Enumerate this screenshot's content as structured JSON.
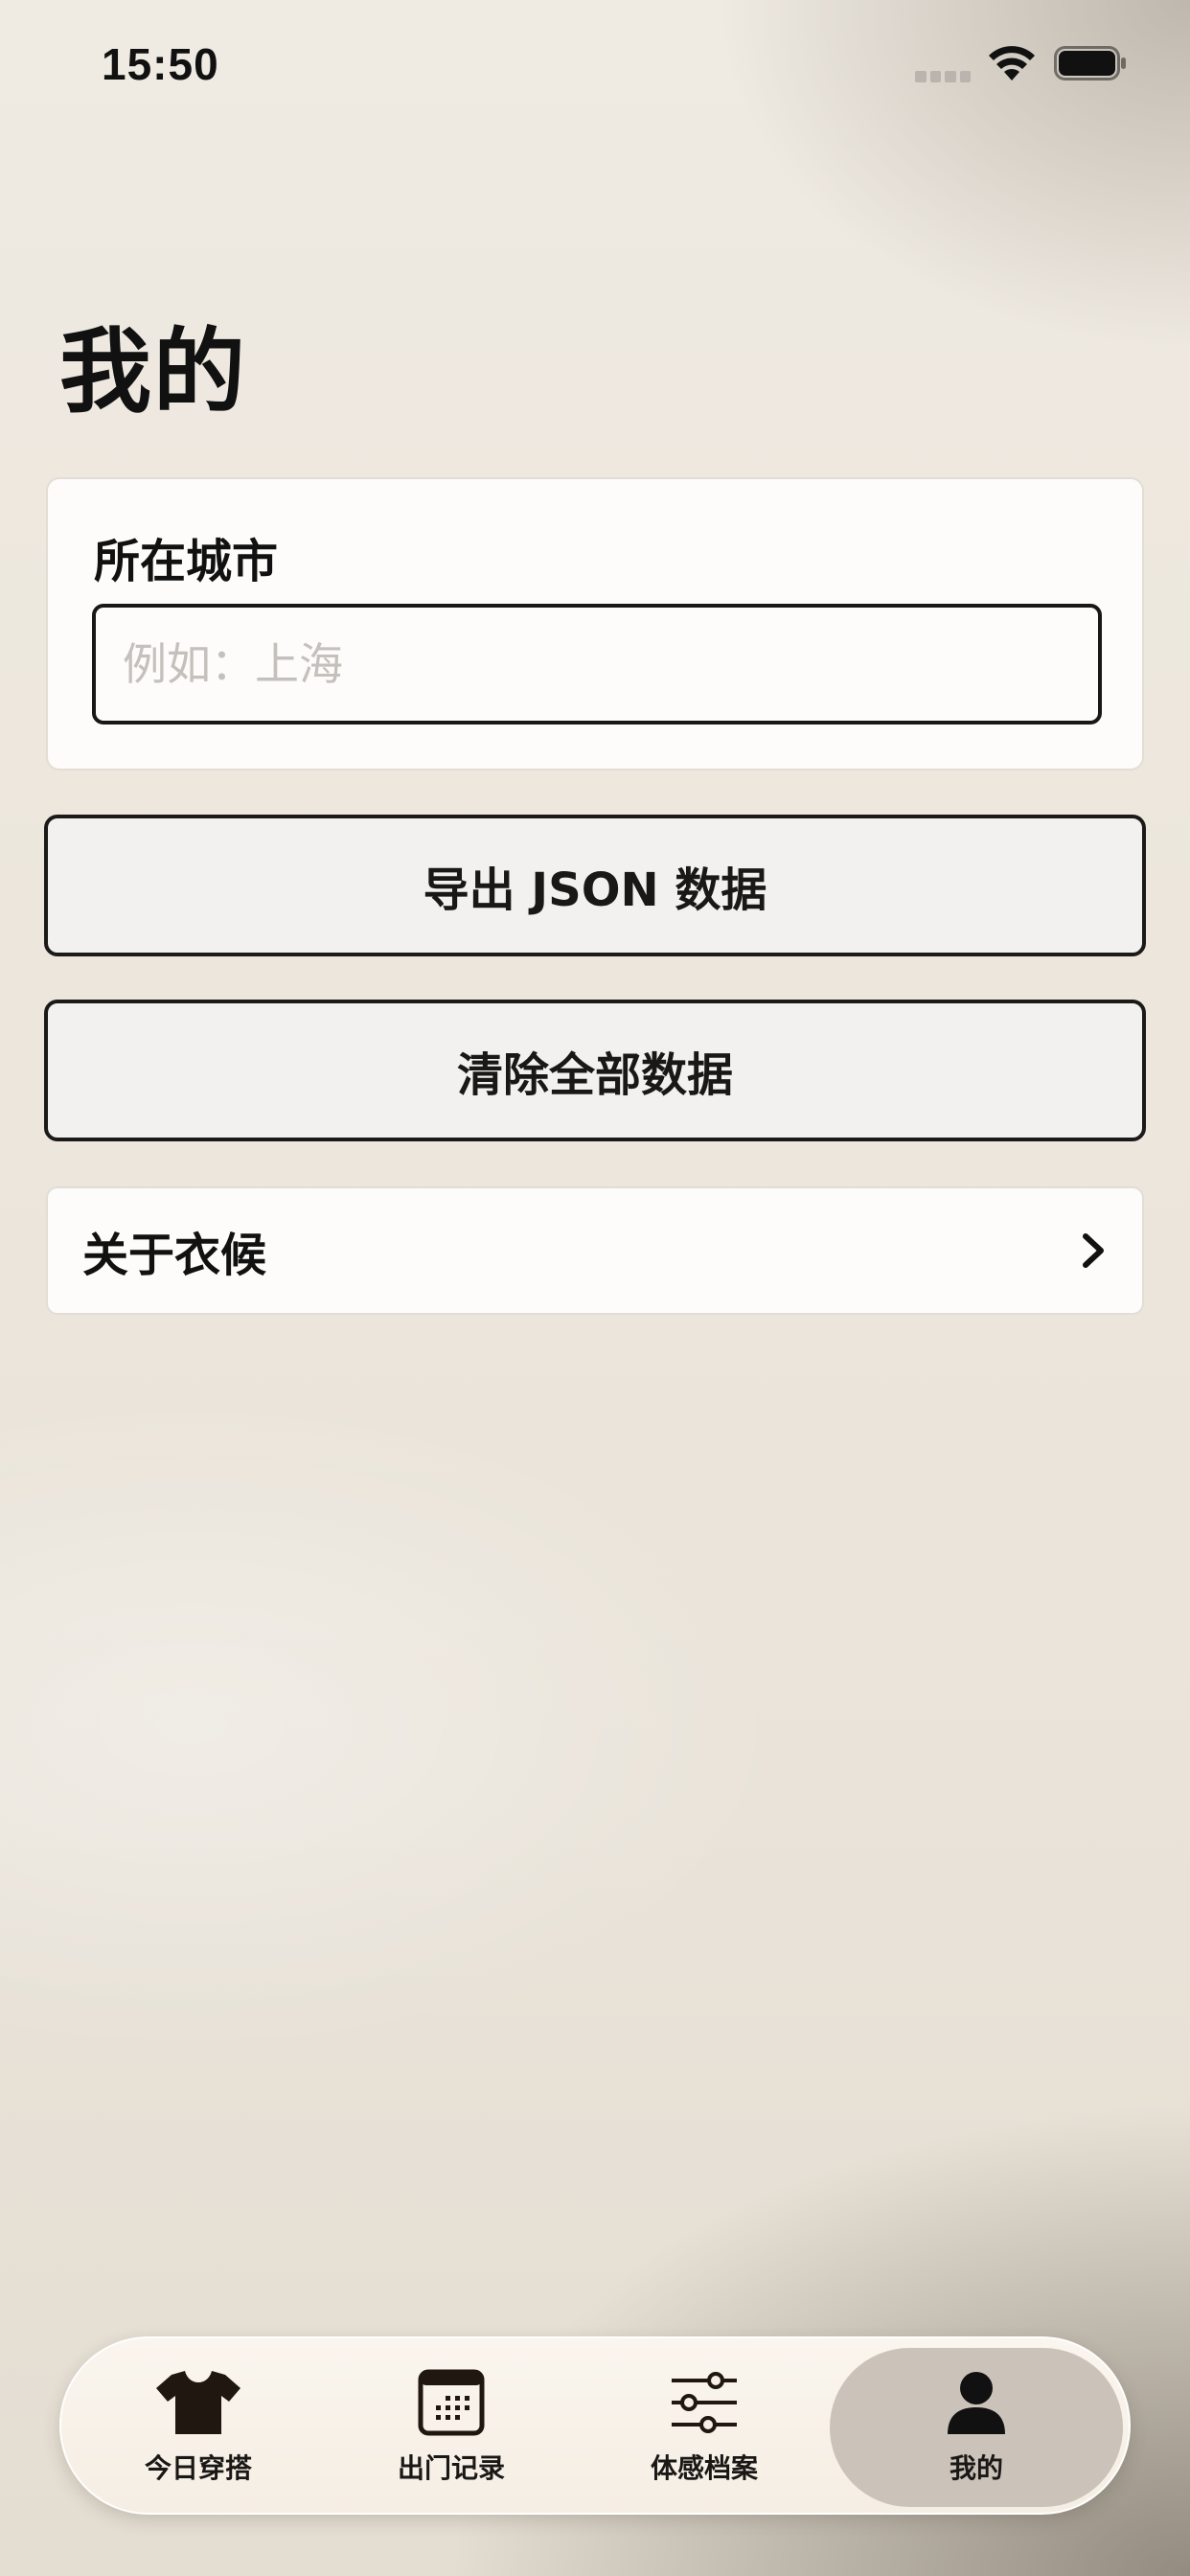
{
  "status_bar": {
    "time": "15:50"
  },
  "page": {
    "title": "我的"
  },
  "city": {
    "label": "所在城市",
    "value": "",
    "placeholder": "例如：上海"
  },
  "actions": {
    "export_label": "导出 JSON 数据",
    "clear_label": "清除全部数据"
  },
  "about": {
    "label": "关于衣候"
  },
  "tab_bar": {
    "tabs": [
      {
        "label": "今日穿搭",
        "icon": "tshirt-icon"
      },
      {
        "label": "出门记录",
        "icon": "calendar-icon"
      },
      {
        "label": "体感档案",
        "icon": "sliders-icon"
      },
      {
        "label": "我的",
        "icon": "person-icon",
        "active": true
      }
    ]
  }
}
